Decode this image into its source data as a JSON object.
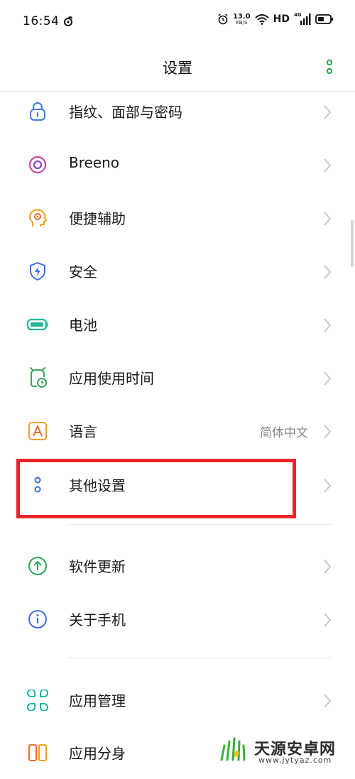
{
  "status_bar": {
    "time": "16:54",
    "net_speed_value": "13.0",
    "net_speed_unit": "KB/S",
    "hd": "HD",
    "network_type": "4G"
  },
  "header": {
    "title": "设置",
    "more_icon": "more-vertical-dots-icon"
  },
  "settings": {
    "items": [
      {
        "label": "指纹、面部与密码",
        "icon": "lock-icon",
        "color": "#3d7be0"
      },
      {
        "label": "Breeno",
        "icon": "breeno-icon",
        "color": "#b043c9"
      },
      {
        "label": "便捷辅助",
        "icon": "assist-head-icon",
        "color": "#f0a020"
      },
      {
        "label": "安全",
        "icon": "shield-bolt-icon",
        "color": "#3d6ee0"
      },
      {
        "label": "电池",
        "icon": "battery-icon",
        "color": "#1fb89a"
      },
      {
        "label": "应用使用时间",
        "icon": "alarm-clock-icon",
        "color": "#3aa455"
      },
      {
        "label": "语言",
        "value": "简体中文",
        "icon": "language-a-icon",
        "color": "#f0a020"
      },
      {
        "label": "其他设置",
        "icon": "other-settings-icon",
        "color": "#3d6ee0"
      },
      {
        "label": "软件更新",
        "icon": "update-arrow-icon",
        "color": "#2aa853"
      },
      {
        "label": "关于手机",
        "icon": "info-icon",
        "color": "#3d6ee0"
      },
      {
        "label": "应用管理",
        "icon": "app-grid-icon",
        "color": "#1fb89a"
      },
      {
        "label": "应用分身",
        "icon": "app-clone-icon",
        "color": "#f06a2a"
      }
    ]
  },
  "highlight": {
    "color": "#e8252e",
    "target": "其他设置"
  },
  "watermark": {
    "title": "天源安卓网",
    "url": "www.jytyaz.com"
  }
}
